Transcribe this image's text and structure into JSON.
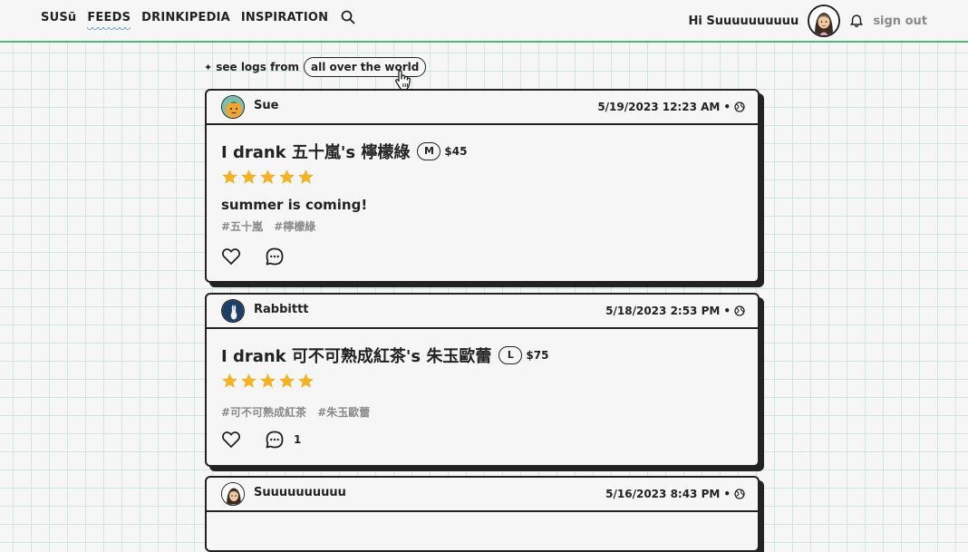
{
  "nav": {
    "logo": "SUSū",
    "feeds": "FEEDS",
    "drinkipedia": "DRINKIPEDIA",
    "inspiration": "INSPIRATION",
    "greeting": "Hi Suuuuuuuuuu",
    "sign_out": "sign out"
  },
  "filter": {
    "prefix": "see logs from",
    "scope": "all over the world"
  },
  "posts": [
    {
      "username": "Sue",
      "timestamp": "5/19/2023 12:23 AM",
      "title": "I drank 五十嵐's 檸檬綠",
      "size": "M",
      "price": "$45",
      "rating": 5,
      "note": "summer is coming!",
      "tags": [
        "#五十嵐",
        "#檸檬綠"
      ],
      "comment_count": ""
    },
    {
      "username": "Rabbittt",
      "timestamp": "5/18/2023 2:53 PM",
      "title": "I drank 可不可熟成紅茶's 朱玉歐蕾",
      "size": "L",
      "price": "$75",
      "rating": 5,
      "note": "",
      "tags": [
        "#可不可熟成紅茶",
        "#朱玉歐蕾"
      ],
      "comment_count": "1"
    },
    {
      "username": "Suuuuuuuuuu",
      "timestamp": "5/16/2023 8:43 PM"
    }
  ],
  "colors": {
    "accent_green": "#54b77a",
    "star": "#f4b225",
    "grid": "#cfe6e3"
  }
}
